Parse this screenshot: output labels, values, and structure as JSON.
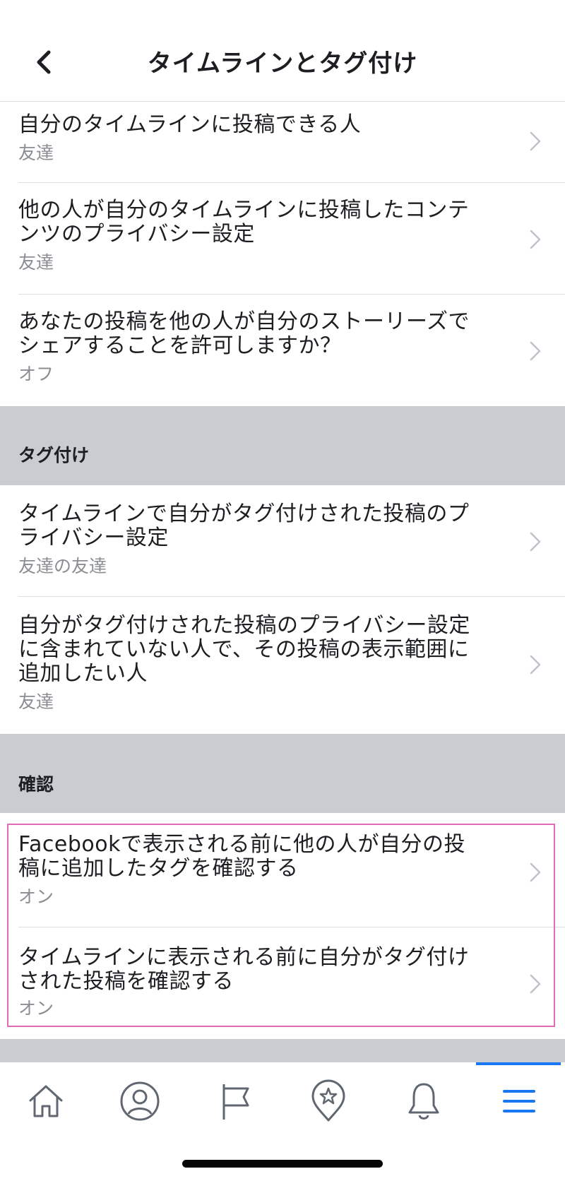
{
  "header": {
    "title": "タイムラインとタグ付け"
  },
  "timeline_rows": [
    {
      "label_lines": [
        "自分のタイムラインに投稿できる人"
      ],
      "value": "友達"
    },
    {
      "label_lines": [
        "他の人が自分のタイムラインに投稿したコンテ",
        "ンツのプライバシー設定"
      ],
      "value": "友達"
    },
    {
      "label_lines": [
        "あなたの投稿を他の人が自分のストーリーズで",
        "シェアすることを許可しますか？"
      ],
      "value": "オフ"
    }
  ],
  "sections": {
    "tagging": "タグ付け",
    "review": "確認"
  },
  "tagging_rows": [
    {
      "label_lines": [
        "タイムラインで自分がタグ付けされた投稿のプ",
        "ライバシー設定"
      ],
      "value": "友達の友達"
    },
    {
      "label_lines": [
        "自分がタグ付けされた投稿のプライバシー設定",
        "に含まれていない人で、その投稿の表示範囲に",
        "追加したい人"
      ],
      "value": "友達"
    }
  ],
  "review_rows": [
    {
      "label_lines": [
        "Facebookで表示される前に他の人が自分の投",
        "稿に追加したタグを確認する"
      ],
      "value": "オン"
    },
    {
      "label_lines": [
        "タイムラインに表示される前に自分がタグ付け",
        "された投稿を確認する"
      ],
      "value": "オン"
    }
  ],
  "tabs": [
    {
      "icon": "home-icon"
    },
    {
      "icon": "profile-icon"
    },
    {
      "icon": "pages-flag-icon"
    },
    {
      "icon": "favorites-badge-icon"
    },
    {
      "icon": "bell-icon"
    },
    {
      "icon": "menu-icon",
      "active": true
    }
  ],
  "colors": {
    "accent": "#1877f2",
    "section_bg": "#c9ccd1",
    "highlight_border": "#e06bb6"
  }
}
